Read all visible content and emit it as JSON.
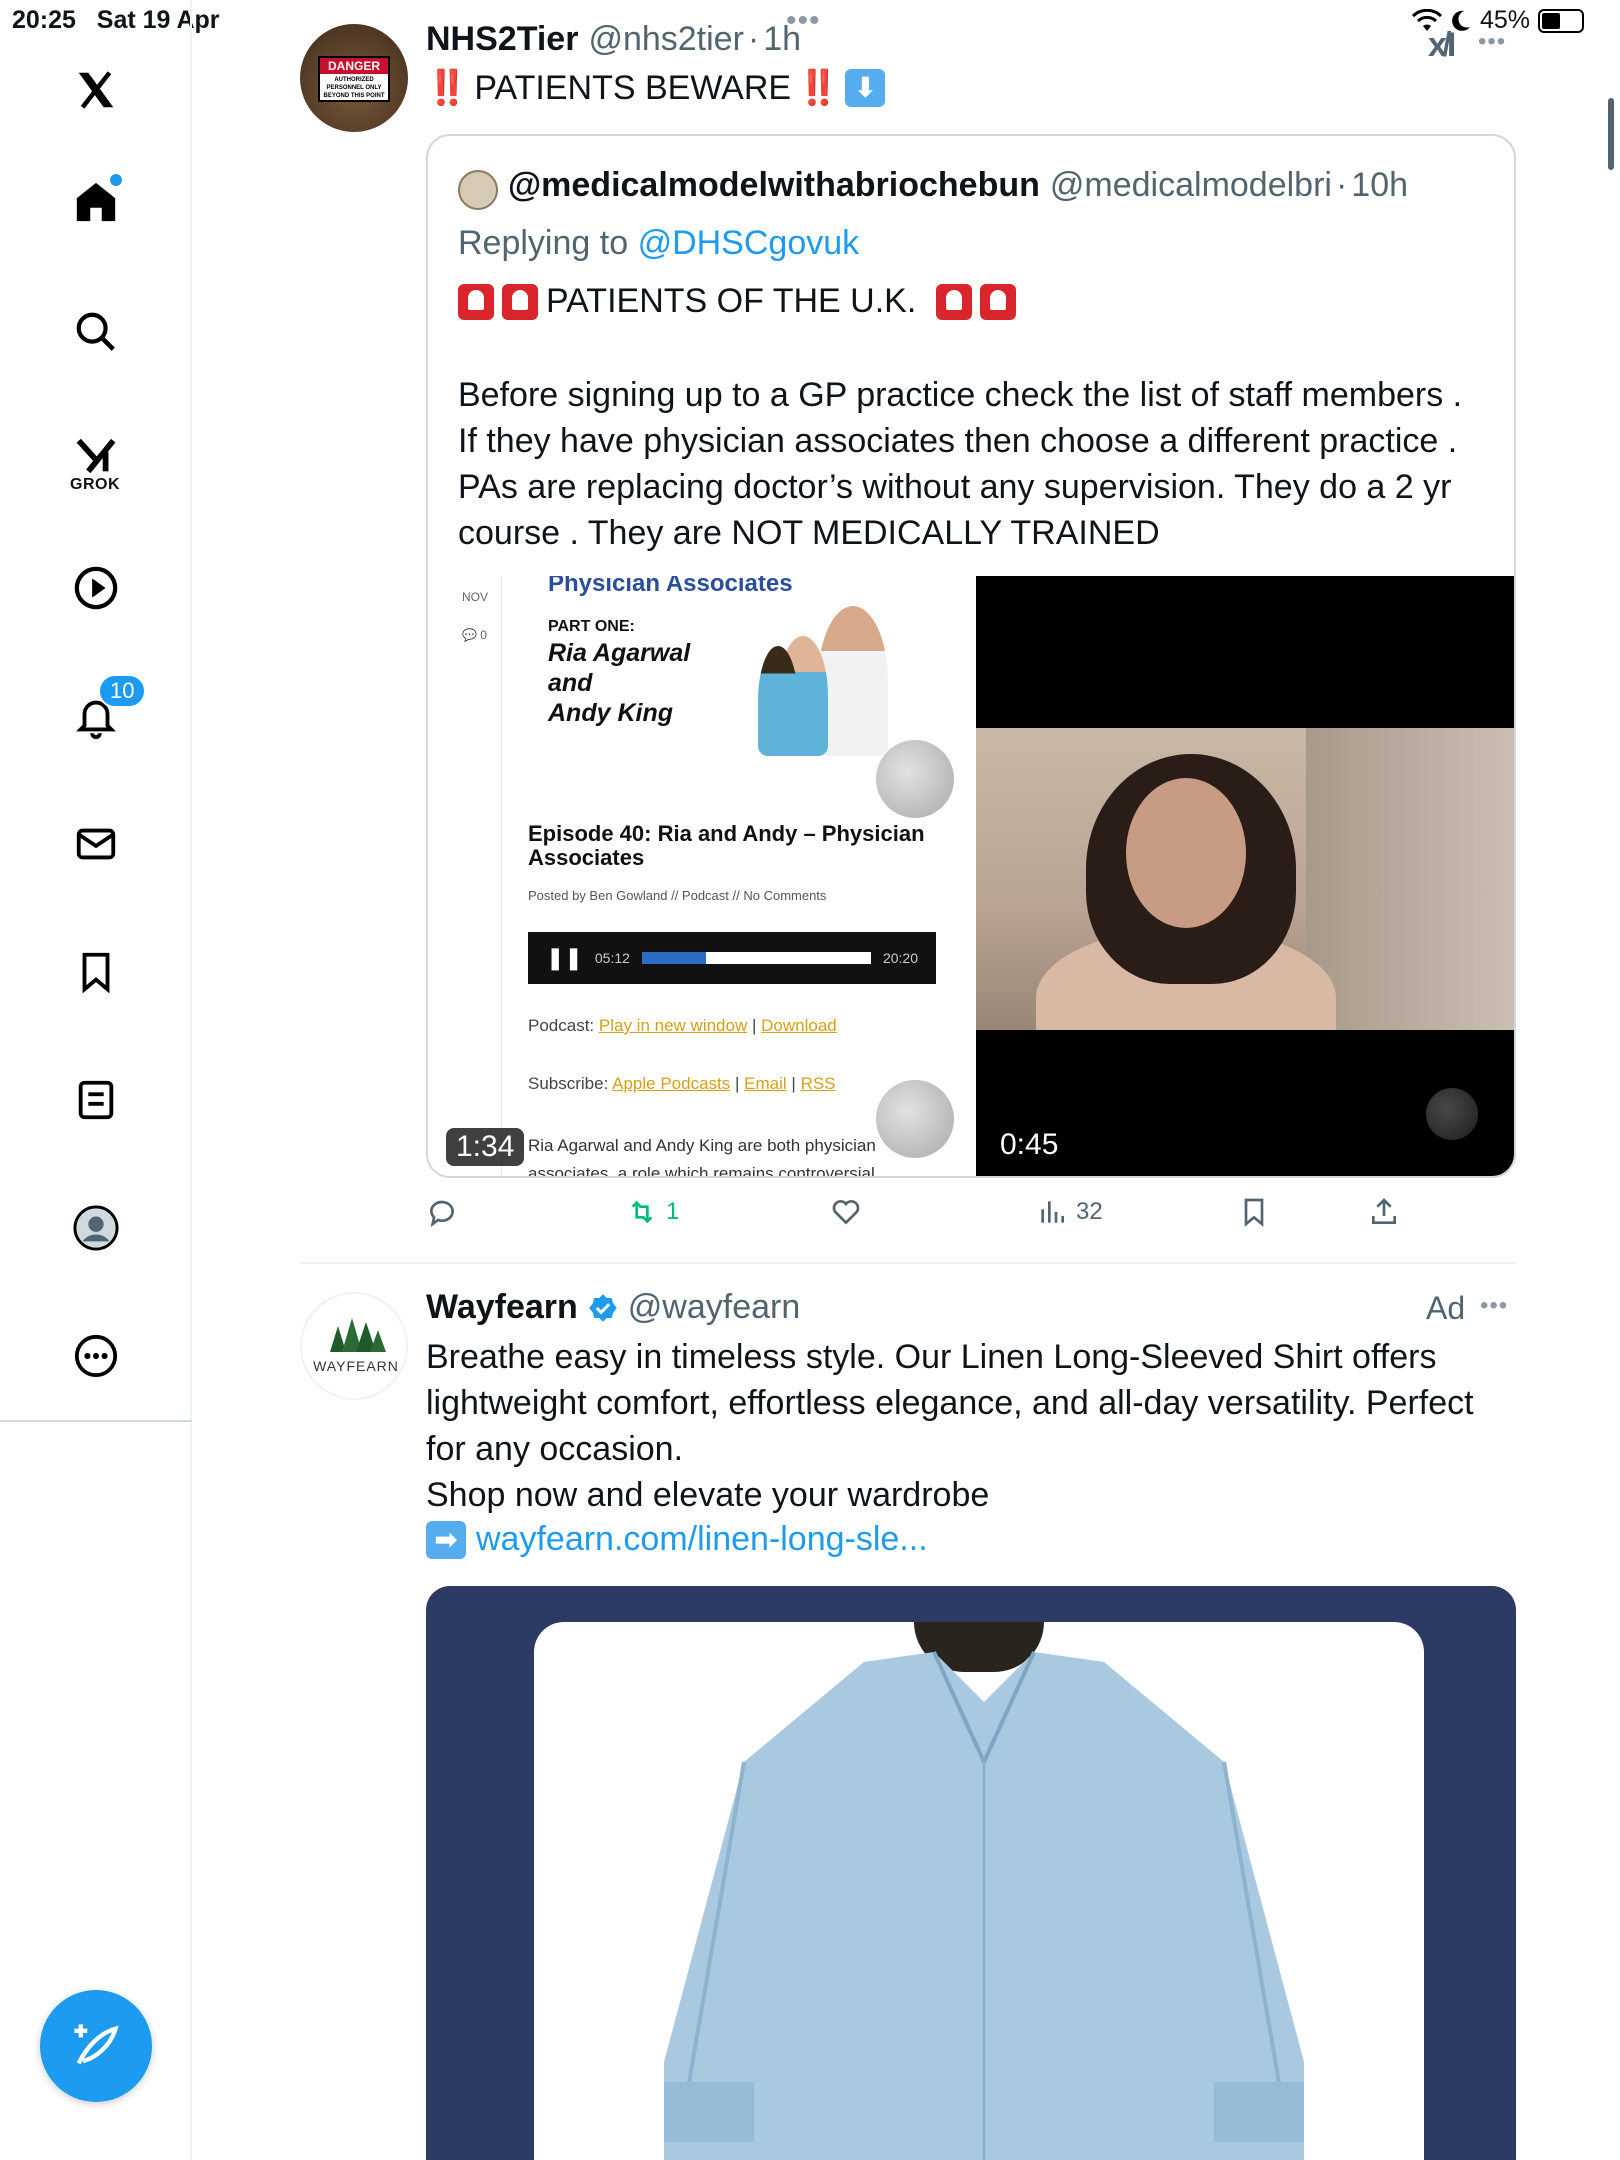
{
  "status_bar": {
    "time": "20:25",
    "date": "Sat 19 Apr",
    "battery": "45%",
    "dots": "•••"
  },
  "sidebar": {
    "items": [
      {
        "icon": "x-logo-icon"
      },
      {
        "icon": "home-icon"
      },
      {
        "icon": "search-icon"
      },
      {
        "icon": "grok-icon",
        "label": "GROK"
      },
      {
        "icon": "video-icon"
      },
      {
        "icon": "notifications-icon",
        "badge": "10"
      },
      {
        "icon": "messages-icon"
      },
      {
        "icon": "bookmarks-icon"
      },
      {
        "icon": "lists-icon"
      },
      {
        "icon": "profile-icon"
      },
      {
        "icon": "more-icon"
      }
    ],
    "compose_icon": "compose-icon"
  },
  "tweet1": {
    "name": "NHS2Tier",
    "handle": "@nhs2tier",
    "sep": "·",
    "time": "1h",
    "bang": "‼️",
    "text": "PATIENTS BEWARE",
    "down_arrow": "⬇",
    "more": "•••",
    "quote": {
      "name": "@medicalmodelwithabriochebun",
      "handle": "@medicalmodelbri",
      "sep": "·",
      "time": "10h",
      "replying_prefix": "Replying to",
      "replying_to": "@DHSCgovuk",
      "headline": "PATIENTS OF THE U.K.",
      "body_lines": [
        "Before signing up to a GP practice check the list of staff members .",
        "If they have physician associates then choose a different practice .",
        "PAs are replacing doctor’s without any supervision. They do a 2 yr",
        "course . They are NOT MEDICALLY TRAINED"
      ],
      "media_left": {
        "nov": "NOV",
        "comments": "0",
        "title_top": "Physician Associates",
        "part": "PART ONE:",
        "names": [
          "Ria Agarwal",
          "and",
          "Andy King"
        ],
        "episode": "Episode 40: Ria and Andy – Physician Associates",
        "posted": "Posted by Ben Gowland // Podcast // No Comments",
        "player_time": "05:12",
        "player_total": "20:20",
        "player_progress": 0.28,
        "podcast_label": "Podcast:",
        "podcast_link1": "Play in new window",
        "podcast_sep": "|",
        "podcast_link2": "Download",
        "subscribe_label": "Subscribe:",
        "subscribe_link1": "Apple Podcasts",
        "subscribe_link2": "Email",
        "subscribe_link3": "RSS",
        "excerpt": "Ria Agarwal and Andy King are both physician associates, a role which remains controversial",
        "duration": "1:34"
      },
      "media_right": {
        "duration": "0:45"
      }
    },
    "actions": {
      "reply": "",
      "retweets": "1",
      "likes": "",
      "views": "32"
    }
  },
  "tweet2": {
    "name": "Wayfearn",
    "handle": "@wayfearn",
    "ad_label": "Ad",
    "more": "•••",
    "avatar_text": "WAYFEARN",
    "body_lines": [
      "Breathe easy in timeless style. Our Linen Long-Sleeved Shirt offers",
      "lightweight comfort, effortless elegance, and all-day versatility. Perfect",
      "for any occasion.",
      "Shop now and elevate your wardrobe"
    ],
    "link_arrow": "➡",
    "link": "wayfearn.com/linen-long-sle..."
  },
  "colors": {
    "accent": "#1d9bf0",
    "retweet": "#00ba7c",
    "muted": "#536471",
    "ad_bg": "#2d3a63"
  }
}
